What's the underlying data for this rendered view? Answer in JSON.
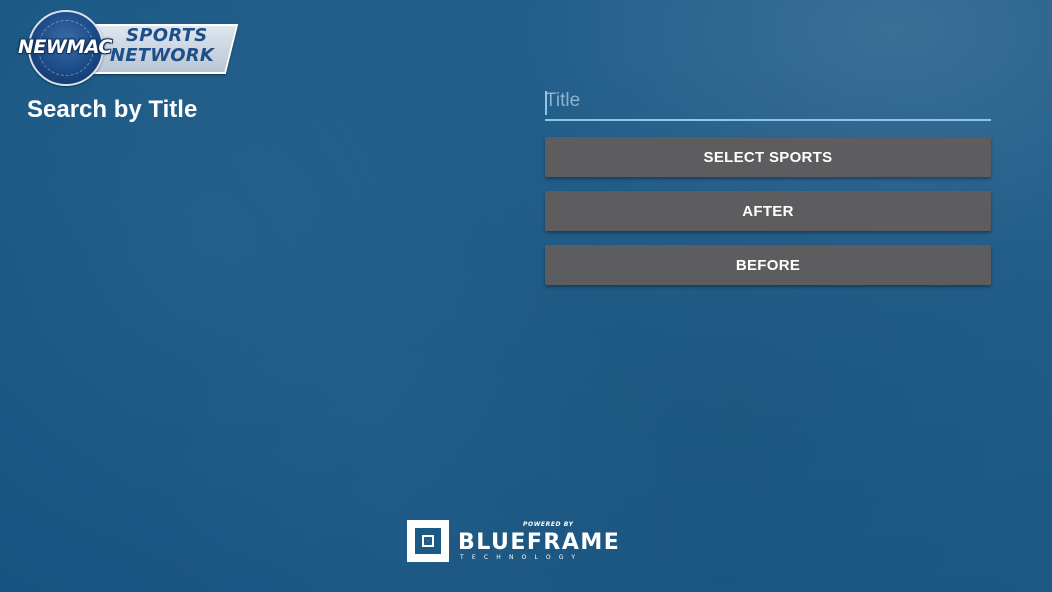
{
  "logo": {
    "name": "NEWMAC",
    "line1": "SPORTS",
    "line2": "NETWORK"
  },
  "page": {
    "title": "Search by Title"
  },
  "search": {
    "placeholder": "Title",
    "value": ""
  },
  "buttons": {
    "select_sports": "SELECT SPORTS",
    "after": "AFTER",
    "before": "BEFORE"
  },
  "footer": {
    "powered_by": "POWERED BY",
    "brand": "BLUEFRAME",
    "tagline": "TECHNOLOGY"
  },
  "colors": {
    "background": "#1c5a86",
    "button": "#5d5d5f",
    "input_underline": "#8fc6e4"
  },
  "icons": {
    "logo_emblem": "newmac-laurel-emblem",
    "footer_mark": "blueframe-aperture-mark"
  }
}
